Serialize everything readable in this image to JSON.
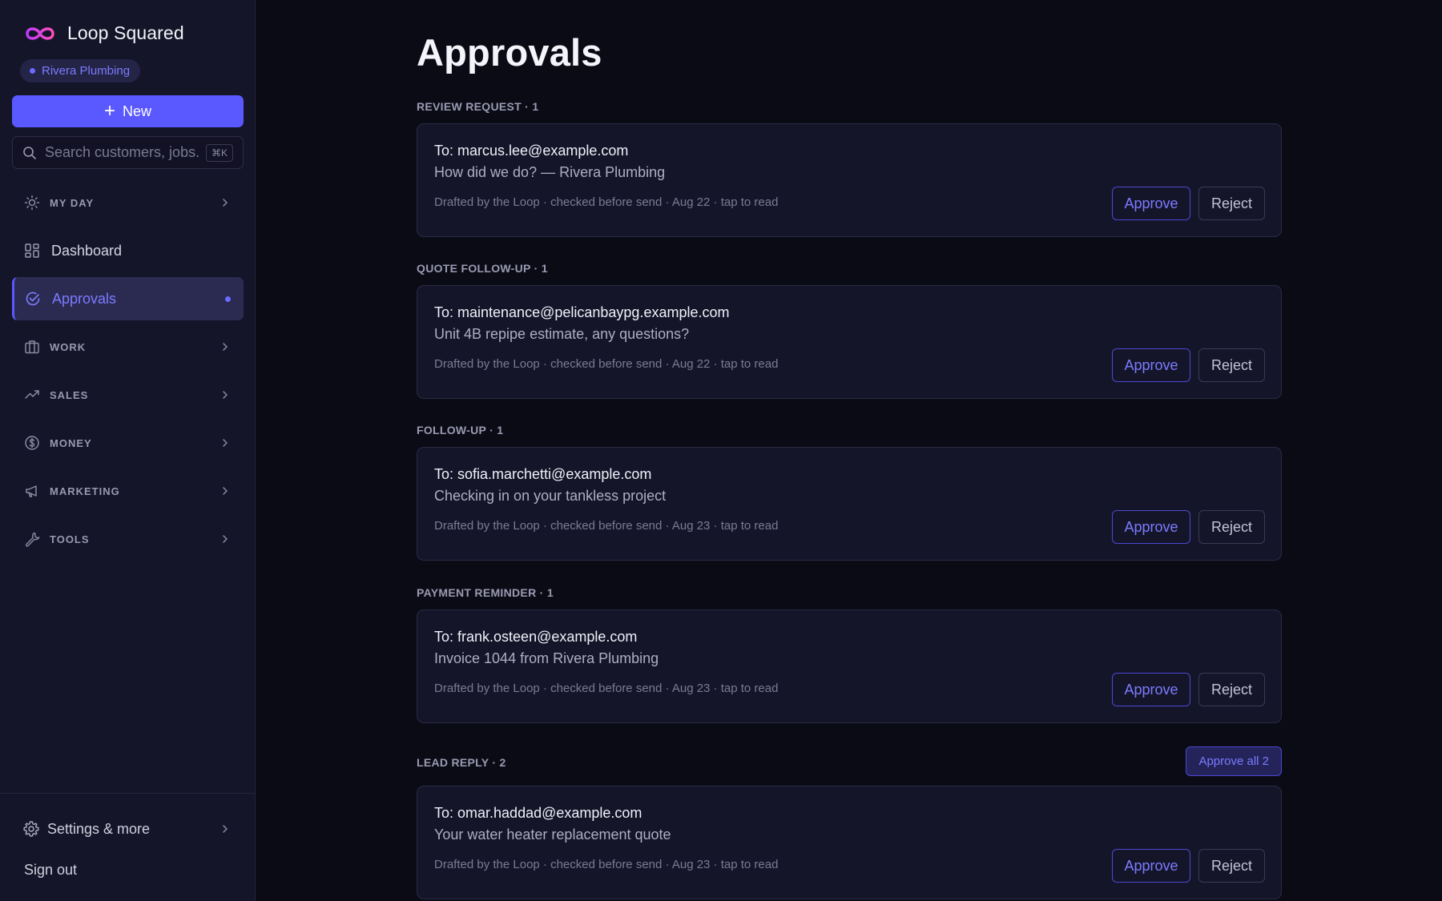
{
  "brand": {
    "name": "Loop Squared",
    "org": "Rivera Plumbing"
  },
  "sidebar": {
    "new_label": "New",
    "search_placeholder": "Search customers, jobs...",
    "search_shortcut": "⌘K",
    "items": [
      {
        "label": "MY DAY",
        "type": "section",
        "icon": "sun-icon"
      },
      {
        "label": "Dashboard",
        "type": "link",
        "icon": "grid-icon"
      },
      {
        "label": "Approvals",
        "type": "link",
        "icon": "check-circle-icon",
        "active": true
      },
      {
        "label": "WORK",
        "type": "section",
        "icon": "briefcase-icon"
      },
      {
        "label": "SALES",
        "type": "section",
        "icon": "trending-up-icon"
      },
      {
        "label": "MONEY",
        "type": "section",
        "icon": "dollar-circle-icon"
      },
      {
        "label": "MARKETING",
        "type": "section",
        "icon": "megaphone-icon"
      },
      {
        "label": "TOOLS",
        "type": "section",
        "icon": "wrench-icon"
      }
    ],
    "settings_label": "Settings & more",
    "signout_label": "Sign out"
  },
  "main": {
    "title": "Approvals",
    "approve_label": "Approve",
    "reject_label": "Reject",
    "groups": [
      {
        "heading": "REVIEW REQUEST · 1",
        "cards": [
          {
            "to": "To: marcus.lee@example.com",
            "subject": "How did we do? — Rivera Plumbing",
            "meta": "Drafted by the Loop · checked before send · Aug 22 · tap to read"
          }
        ]
      },
      {
        "heading": "QUOTE FOLLOW-UP · 1",
        "cards": [
          {
            "to": "To: maintenance@pelicanbaypg.example.com",
            "subject": "Unit 4B repipe estimate, any questions?",
            "meta": "Drafted by the Loop · checked before send · Aug 22 · tap to read"
          }
        ]
      },
      {
        "heading": "FOLLOW-UP · 1",
        "cards": [
          {
            "to": "To: sofia.marchetti@example.com",
            "subject": "Checking in on your tankless project",
            "meta": "Drafted by the Loop · checked before send · Aug 23 · tap to read"
          }
        ]
      },
      {
        "heading": "PAYMENT REMINDER · 1",
        "cards": [
          {
            "to": "To: frank.osteen@example.com",
            "subject": "Invoice 1044 from Rivera Plumbing",
            "meta": "Drafted by the Loop · checked before send · Aug 23 · tap to read"
          }
        ]
      },
      {
        "heading": "LEAD REPLY · 2",
        "approve_all_label": "Approve all 2",
        "cards": [
          {
            "to": "To: omar.haddad@example.com",
            "subject": "Your water heater replacement quote",
            "meta": "Drafted by the Loop · checked before send · Aug 23 · tap to read"
          }
        ]
      }
    ]
  },
  "colors": {
    "accent": "#5a58ff",
    "background": "#0b0b16",
    "sidebar": "#15152a"
  }
}
